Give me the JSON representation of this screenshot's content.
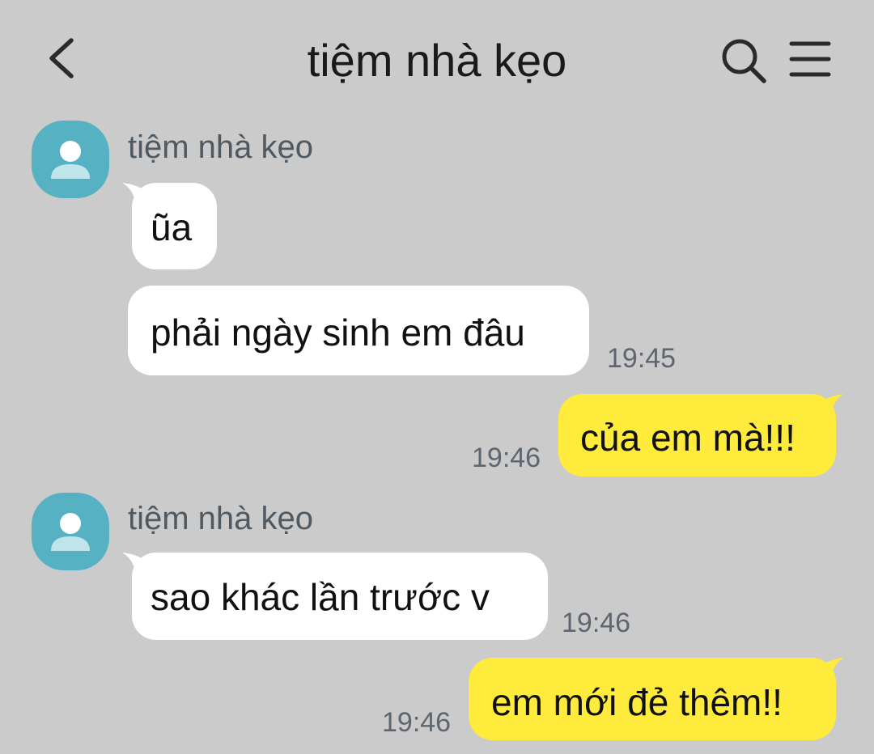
{
  "header": {
    "title": "tiệm nhà kẹo",
    "back_icon": "chevron-left-icon",
    "search_icon": "search-icon",
    "menu_icon": "hamburger-menu-icon"
  },
  "colors": {
    "background": "#cbcbcb",
    "incoming_bubble": "#ffffff",
    "outgoing_bubble": "#ffeb3b",
    "avatar": "#56b2c2",
    "timestamp": "#5d6670"
  },
  "messages": [
    {
      "direction": "incoming",
      "sender": "tiệm nhà kẹo",
      "text": "ũa",
      "time": ""
    },
    {
      "direction": "incoming",
      "sender": "tiệm nhà kẹo",
      "text": "phải ngày sinh em đâu",
      "time": "19:45"
    },
    {
      "direction": "outgoing",
      "text": "của em mà!!!",
      "time": "19:46"
    },
    {
      "direction": "incoming",
      "sender": "tiệm nhà kẹo",
      "text": "sao khác lần trước v",
      "time": "19:46"
    },
    {
      "direction": "outgoing",
      "text": "em mới đẻ thêm!!",
      "time": "19:46"
    }
  ]
}
